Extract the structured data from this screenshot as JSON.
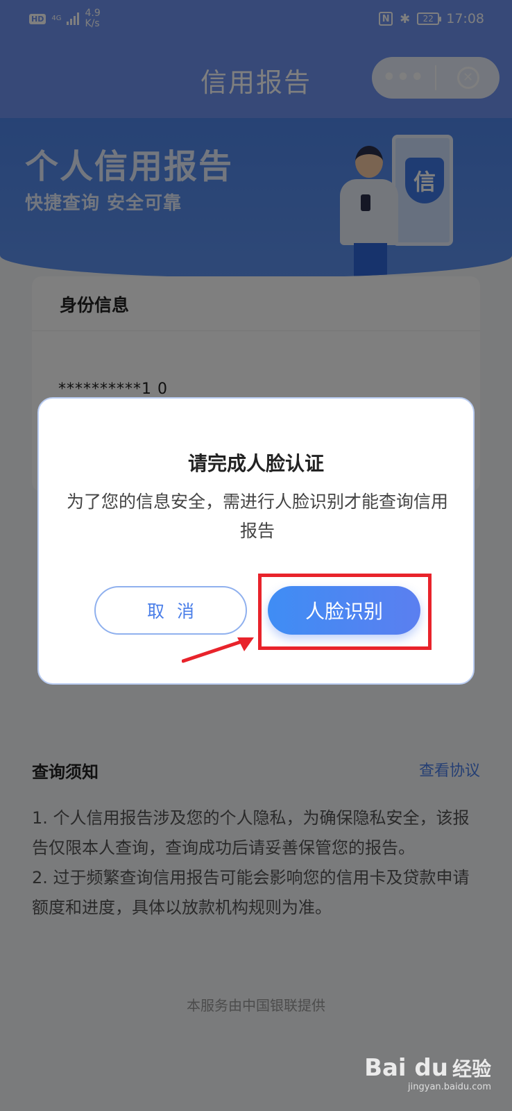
{
  "status_bar": {
    "hd": "HD",
    "network": "4G",
    "speed_value": "4.9",
    "speed_unit": "K/s",
    "nfc": "N",
    "battery": "22",
    "time": "17:08"
  },
  "nav": {
    "title": "信用报告",
    "more_label": "•••",
    "close_label": "✕"
  },
  "banner": {
    "title": "个人信用报告",
    "subtitle": "快捷查询   安全可靠",
    "shield_char": "信"
  },
  "identity": {
    "title": "身份信息",
    "id_masked": "**********1  0"
  },
  "dialog": {
    "title": "请完成人脸认证",
    "message": "为了您的信息安全，需进行人脸识别才能查询信用报告",
    "cancel_label": "取消",
    "confirm_label": "人脸识别"
  },
  "notice": {
    "title": "查询须知",
    "link": "查看协议",
    "item1": "1. 个人信用报告涉及您的个人隐私，为确保隐私安全，该报告仅限本人查询，查询成功后请妥善保管您的报告。",
    "item2": "2. 过于频繁查询信用报告可能会影响您的信用卡及贷款申请额度和进度，具体以放款机构规则为准。"
  },
  "footer": {
    "text": "本服务由中国银联提供"
  },
  "watermark": {
    "logo": "Bai du",
    "cn": "经验",
    "url": "jingyan.baidu.com"
  },
  "colors": {
    "header": "#6f93f0",
    "banner": "#4f86ea",
    "accent": "#4a7ee8",
    "highlight": "#e8232b"
  }
}
